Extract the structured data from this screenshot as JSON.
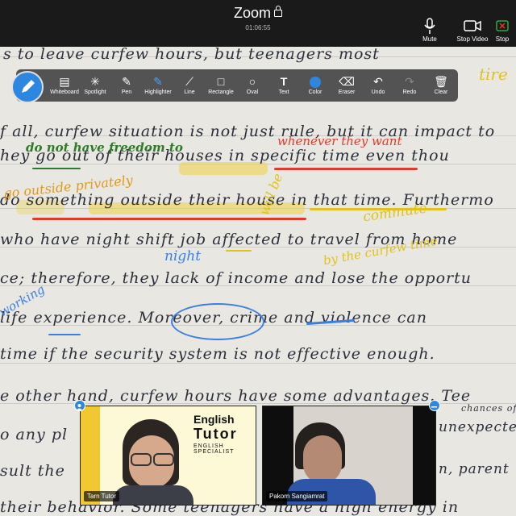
{
  "window": {
    "title": "Zoom",
    "timer": "01:06:55"
  },
  "topbar": {
    "right": [
      {
        "label": "Mute",
        "icon": "microphone-icon"
      },
      {
        "label": "Stop Video",
        "icon": "video-camera-icon"
      },
      {
        "label": "Stop",
        "icon": "stop-share-icon"
      }
    ]
  },
  "annotation_toolbar": {
    "tools": [
      {
        "label": "Whiteboard",
        "icon": "whiteboard-icon"
      },
      {
        "label": "Spotlight",
        "icon": "spotlight-icon"
      },
      {
        "label": "Pen",
        "icon": "pen-icon"
      },
      {
        "label": "Highlighter",
        "icon": "highlighter-icon"
      },
      {
        "label": "Line",
        "icon": "line-icon"
      },
      {
        "label": "Rectangle",
        "icon": "rectangle-icon"
      },
      {
        "label": "Oval",
        "icon": "oval-icon"
      },
      {
        "label": "Text",
        "icon": "text-icon"
      },
      {
        "label": "Color",
        "icon": "color-icon"
      },
      {
        "label": "Eraser",
        "icon": "eraser-icon"
      },
      {
        "label": "Undo",
        "icon": "undo-icon"
      },
      {
        "label": "Redo",
        "icon": "redo-icon"
      },
      {
        "label": "Clear",
        "icon": "trash-icon"
      }
    ],
    "active_color": "#2d86e0"
  },
  "document": {
    "lines": [
      "s to leave curfew hours, but teenagers most",
      "f all, curfew situation is not just rule, but it can impact to",
      "hey          go out of their houses in specific time even thou",
      "do something outside their house in that time. Furthermo",
      "who have night shift job affected to travel from home",
      "ce; therefore, they lack of income and lose the opportu",
      "life experience. Moreover, crime and violence can",
      "time if the security system is not effective enough.",
      "e other hand, curfew hours have some advantages. Tee",
      "o any pl",
      "sult the",
      "their behavior. Some teenagers have a high energy in"
    ],
    "right_fragments": {
      "chances": "chances of",
      "unexpected": "unexpected",
      "parent": "n, parent"
    }
  },
  "annotations": {
    "green": "do not have freedom to",
    "red": "whenever they want",
    "orange": "go outside privately",
    "yellow_will_be": "will be",
    "yellow_commute": "commute",
    "yellow_by": "by the curfew time",
    "yellow_tire": "tire",
    "blue_night": "night",
    "blue_working": "working"
  },
  "participants": [
    {
      "name": "Tarn Tutor",
      "banner_line1": "English",
      "banner_line2": "Tutor",
      "banner_line3": "ENGLISH SPECIALIST"
    },
    {
      "name": "Pakorn Sangiamrat"
    }
  ],
  "colors": {
    "topbar": "#1a1a1a",
    "red_ann": "#e03a2c",
    "yellow_ann": "#e0c21c",
    "blue_ann": "#3c7fe0",
    "green_ann": "#2e7a2a"
  }
}
